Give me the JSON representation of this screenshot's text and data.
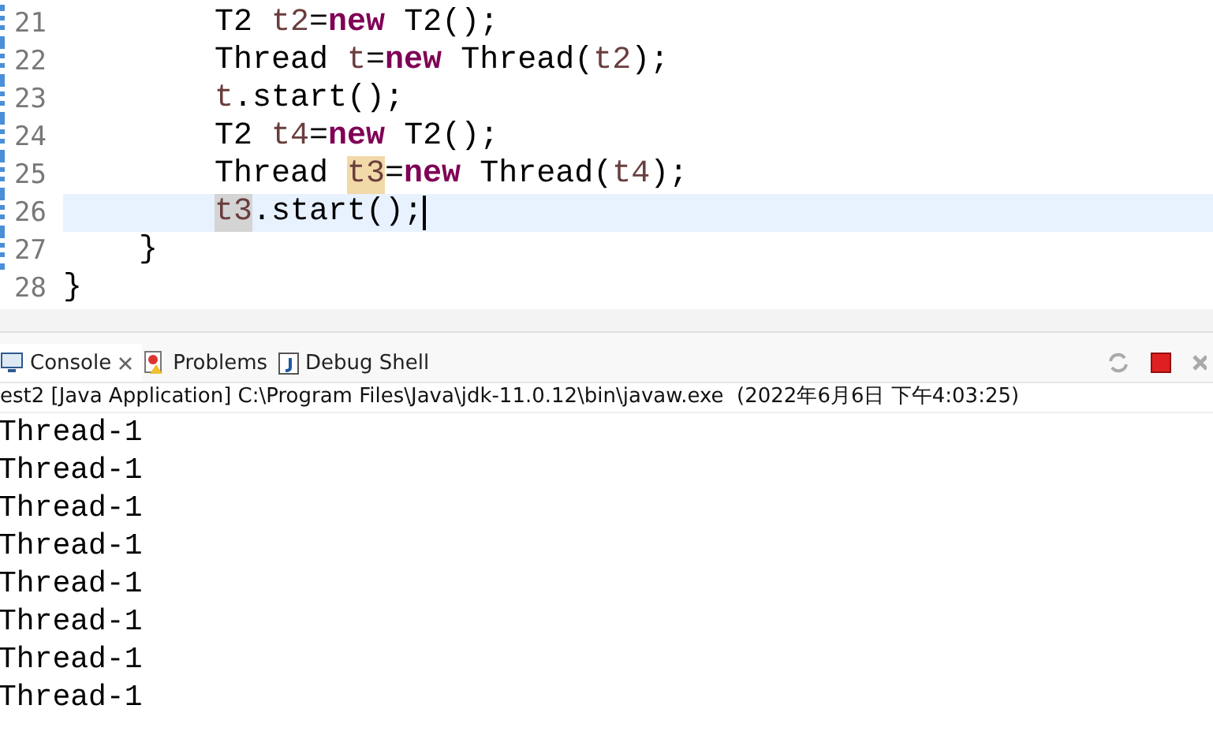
{
  "editor": {
    "lines": [
      {
        "number": "21",
        "kind": "statement",
        "current": false,
        "tokens": [
          {
            "text": "T2 ",
            "kind": "plain"
          },
          {
            "text": "t2",
            "kind": "local"
          },
          {
            "text": "=",
            "kind": "plain"
          },
          {
            "text": "new",
            "kind": "keyword"
          },
          {
            "text": " T2();",
            "kind": "plain"
          }
        ]
      },
      {
        "number": "22",
        "kind": "statement",
        "current": false,
        "tokens": [
          {
            "text": "Thread ",
            "kind": "plain"
          },
          {
            "text": "t",
            "kind": "local"
          },
          {
            "text": "=",
            "kind": "plain"
          },
          {
            "text": "new",
            "kind": "keyword"
          },
          {
            "text": " Thread(",
            "kind": "plain"
          },
          {
            "text": "t2",
            "kind": "local"
          },
          {
            "text": ");",
            "kind": "plain"
          }
        ]
      },
      {
        "number": "23",
        "kind": "statement",
        "current": false,
        "tokens": [
          {
            "text": "t",
            "kind": "local"
          },
          {
            "text": ".start();",
            "kind": "plain"
          }
        ]
      },
      {
        "number": "24",
        "kind": "statement",
        "current": false,
        "tokens": [
          {
            "text": "T2 ",
            "kind": "plain"
          },
          {
            "text": "t4",
            "kind": "local"
          },
          {
            "text": "=",
            "kind": "plain"
          },
          {
            "text": "new",
            "kind": "keyword"
          },
          {
            "text": " T2();",
            "kind": "plain"
          }
        ]
      },
      {
        "number": "25",
        "kind": "statement",
        "current": false,
        "tokens": [
          {
            "text": "Thread ",
            "kind": "plain"
          },
          {
            "text": "t3",
            "kind": "occurrence-write"
          },
          {
            "text": "=",
            "kind": "plain"
          },
          {
            "text": "new",
            "kind": "keyword"
          },
          {
            "text": " Thread(",
            "kind": "plain"
          },
          {
            "text": "t4",
            "kind": "local"
          },
          {
            "text": ");",
            "kind": "plain"
          }
        ]
      },
      {
        "number": "26",
        "kind": "statement",
        "current": true,
        "tokens": [
          {
            "text": "t3",
            "kind": "occurrence-read"
          },
          {
            "text": ".start();",
            "kind": "plain"
          }
        ]
      },
      {
        "number": "27",
        "kind": "method-end",
        "current": false,
        "tokens": [
          {
            "text": "}",
            "kind": "plain"
          }
        ]
      },
      {
        "number": "28",
        "kind": "class-end",
        "current": false,
        "tokens": [
          {
            "text": "}",
            "kind": "plain"
          }
        ]
      }
    ]
  },
  "console": {
    "tabs": [
      {
        "label": "Console",
        "selected": true
      },
      {
        "label": "Problems",
        "selected": false
      },
      {
        "label": "Debug Shell",
        "selected": false
      }
    ],
    "status": "est2 [Java Application] C:\\Program Files\\Java\\jdk-11.0.12\\bin\\javaw.exe  (2022年6月6日 下午4:03:25)",
    "output": [
      "Thread-1",
      "Thread-1",
      "Thread-1",
      "Thread-1",
      "Thread-1",
      "Thread-1",
      "Thread-1",
      "Thread-1"
    ]
  }
}
